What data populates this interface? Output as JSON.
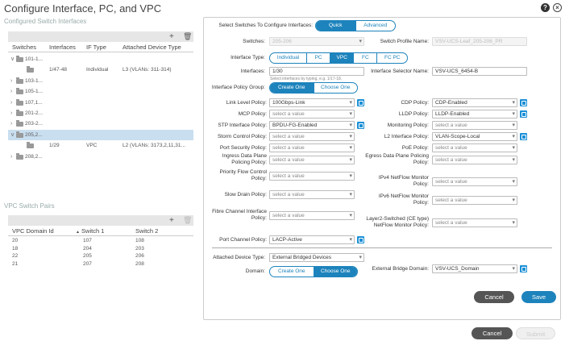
{
  "title": "Configure Interface, PC, and VPC",
  "left": {
    "switch_section_title": "Configured Switch Interfaces",
    "columns": [
      "Switches",
      "Interfaces",
      "IF Type",
      "Attached Device Type"
    ],
    "tree": [
      {
        "label": "101-1...",
        "expanded": true
      },
      {
        "label": "",
        "interface": "1/47-48",
        "iftype": "Individual",
        "attached": "L3 (VLANs: 311-314)"
      },
      {
        "label": "103-1...",
        "expanded": false
      },
      {
        "label": "105-1...",
        "expanded": false
      },
      {
        "label": "107,1...",
        "expanded": false
      },
      {
        "label": "201-2...",
        "expanded": false
      },
      {
        "label": "203-2...",
        "expanded": false
      },
      {
        "label": "205,2...",
        "expanded": true,
        "selected": true
      },
      {
        "label": "",
        "interface": "1/29",
        "iftype": "VPC",
        "attached": "L2 (VLANs: 3173,2,11,31..."
      },
      {
        "label": "208,2...",
        "expanded": false
      }
    ],
    "vpc_section_title": "VPC Switch Pairs",
    "vpc_columns": [
      "VPC Domain Id",
      "Switch 1",
      "Switch 2"
    ],
    "vpc_rows": [
      [
        "20",
        "107",
        "108"
      ],
      [
        "18",
        "204",
        "203"
      ],
      [
        "22",
        "205",
        "206"
      ],
      [
        "21",
        "207",
        "208"
      ]
    ]
  },
  "panel": {
    "select_label": "Select Switches To Configure Interfaces:",
    "mode_options": [
      "Quick",
      "Advanced"
    ],
    "switches_label": "Switches:",
    "switches_value": "205-206",
    "profile_label": "Switch Profile Name:",
    "profile_value": "VSV-UCS-Leaf_205-206_PR",
    "if_type_label": "Interface Type:",
    "if_types": [
      "Individual",
      "PC",
      "VPC",
      "FC",
      "FC PC"
    ],
    "interfaces_label": "Interfaces:",
    "interfaces_value": "1/30",
    "interfaces_hint": "Select interfaces by typing, e.g. 1/17-18.",
    "selector_label": "Interface Selector Name:",
    "selector_value": "VSV-UCS_6454-B",
    "policy_group_label": "Interface Policy Group:",
    "policy_group_options": [
      "Create One",
      "Choose One"
    ],
    "policies_left": [
      {
        "label": "Link Level Policy:",
        "value": "100Gbps-Link",
        "set": true,
        "link": true
      },
      {
        "label": "MCP Policy:",
        "value": "select a value",
        "set": false,
        "link": false
      },
      {
        "label": "STP Interface Policy:",
        "value": "BPDU-FG-Enabled",
        "set": true,
        "link": true
      },
      {
        "label": "Storm Control Policy:",
        "value": "select a value",
        "set": false,
        "link": false
      },
      {
        "label": "Port Security Policy:",
        "value": "select a value",
        "set": false,
        "link": false
      },
      {
        "label": "Ingress Data Plane Policing Policy:",
        "value": "select a value",
        "set": false,
        "link": false
      },
      {
        "label": "Priority Flow Control Policy:",
        "value": "select a value",
        "set": false,
        "link": false
      },
      {
        "label": "Slow Drain Policy:",
        "value": "select a value",
        "set": false,
        "link": false
      },
      {
        "label": "Fibre Channel Interface Policy:",
        "value": "select a value",
        "set": false,
        "link": false
      },
      {
        "label": "Port Channel Policy:",
        "value": "LACP-Active",
        "set": true,
        "link": true
      }
    ],
    "policies_right": [
      {
        "label": "CDP Policy:",
        "value": "CDP-Enabled",
        "set": true,
        "link": true
      },
      {
        "label": "LLDP Policy:",
        "value": "LLDP-Enabled",
        "set": true,
        "link": true
      },
      {
        "label": "Monitoring Policy:",
        "value": "select a value",
        "set": false,
        "link": false
      },
      {
        "label": "L2 Interface Policy:",
        "value": "VLAN-Scope-Local",
        "set": true,
        "link": true
      },
      {
        "label": "PoE Policy:",
        "value": "select a value",
        "set": false,
        "link": false
      },
      {
        "label": "Egress Data Plane Policing Policy:",
        "value": "select a value",
        "set": false,
        "link": false
      },
      {
        "label": "IPv4 NetFlow Monitor Policy:",
        "value": "select a value",
        "set": false,
        "link": false
      },
      {
        "label": "IPv6 NetFlow Monitor Policy:",
        "value": "select a value",
        "set": false,
        "link": false
      },
      {
        "label": "Layer2-Switched (CE type) NetFlow Monitor Policy:",
        "value": "select a value",
        "set": false,
        "link": false
      }
    ],
    "attached_label": "Attached Device Type:",
    "attached_value": "External Bridged Devices",
    "domain_label": "Domain:",
    "domain_options": [
      "Create One",
      "Choose One"
    ],
    "ext_domain_label": "External Bridge Domain:",
    "ext_domain_value": "VSV-UCS_Domain",
    "cancel": "Cancel",
    "save": "Save"
  },
  "footer": {
    "cancel": "Cancel",
    "submit": "Submit"
  },
  "colors": {
    "accent": "#1d83bc",
    "dark_button": "#555555"
  }
}
